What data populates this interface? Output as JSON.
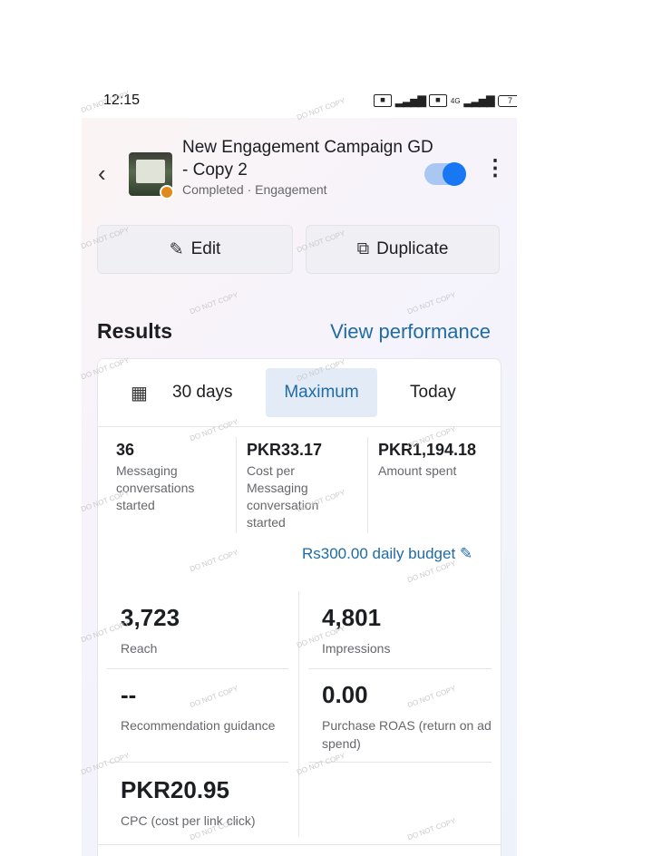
{
  "status_bar": {
    "time": "12:15",
    "network": "4G",
    "battery": "7"
  },
  "header": {
    "campaign_name": "New Engagement Campaign GD - Copy 2",
    "status": "Completed · Engagement"
  },
  "actions": {
    "edit_label": "Edit",
    "duplicate_label": "Duplicate"
  },
  "results": {
    "title": "Results",
    "view_performance": "View performance",
    "tabs": [
      "30 days",
      "Maximum",
      "Today"
    ],
    "selected_tab": "Maximum",
    "summary": [
      {
        "value": "36",
        "label": "Messaging conversations started"
      },
      {
        "value": "PKR33.17",
        "label": "Cost per Messaging conversation started"
      },
      {
        "value": "PKR1,194.18",
        "label": "Amount spent"
      }
    ],
    "daily_budget": "Rs300.00 daily budget",
    "metrics": {
      "reach": {
        "value": "3,723",
        "label": "Reach"
      },
      "impressions": {
        "value": "4,801",
        "label": "Impressions"
      },
      "recommendation": {
        "value": "--",
        "label": "Recommendation guidance"
      },
      "roas": {
        "value": "0.00",
        "label": "Purchase ROAS (return on ad spend)"
      },
      "cpc": {
        "value": "PKR20.95",
        "label": "CPC (cost per link click)"
      }
    }
  },
  "watermark": "DO NOT COPY",
  "colors": {
    "accent": "#1877f2",
    "link": "#1f6ba5",
    "status_dot": "#e08a1e"
  }
}
